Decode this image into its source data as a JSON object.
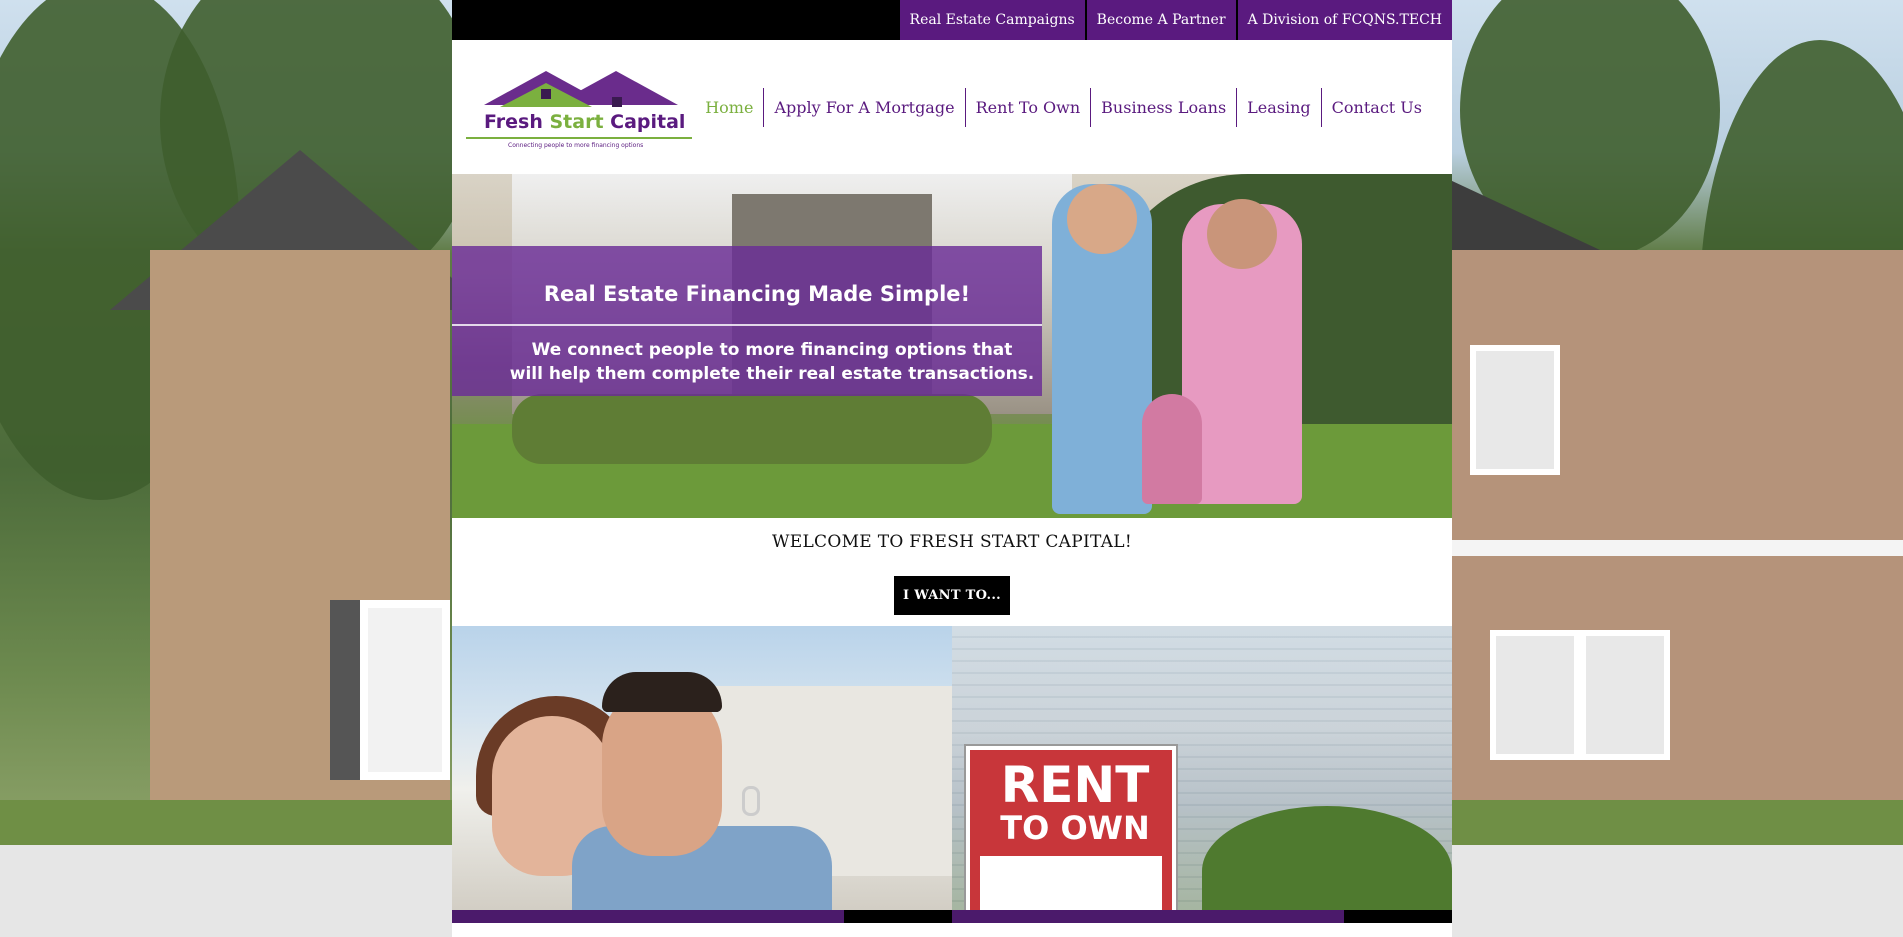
{
  "topbar": {
    "links": [
      "Real Estate Campaigns",
      "Become A Partner",
      "A Division of FCQNS.TECH"
    ]
  },
  "logo": {
    "name_part1": "Fresh ",
    "name_part2": "Start",
    "name_part3": " Capital",
    "tagline": "Connecting people to more financing options"
  },
  "nav": {
    "items": [
      "Home",
      "Apply For A Mortgage",
      "Rent To Own",
      "Business Loans",
      "Leasing",
      "Contact Us"
    ],
    "active": "Home"
  },
  "hero": {
    "title": "Real Estate Financing Made Simple!",
    "text_line1": "We connect people to more financing options that",
    "text_line2": "will help them complete their real estate transactions."
  },
  "welcome": {
    "heading": "WELCOME TO FRESH START CAPITAL!",
    "button": "I WANT TO..."
  },
  "tiles": {
    "right_sign_line1": "RENT",
    "right_sign_line2": "TO OWN"
  },
  "colors": {
    "brand_purple": "#5a1a7f",
    "brand_green": "#7bb03f",
    "black": "#000000"
  }
}
